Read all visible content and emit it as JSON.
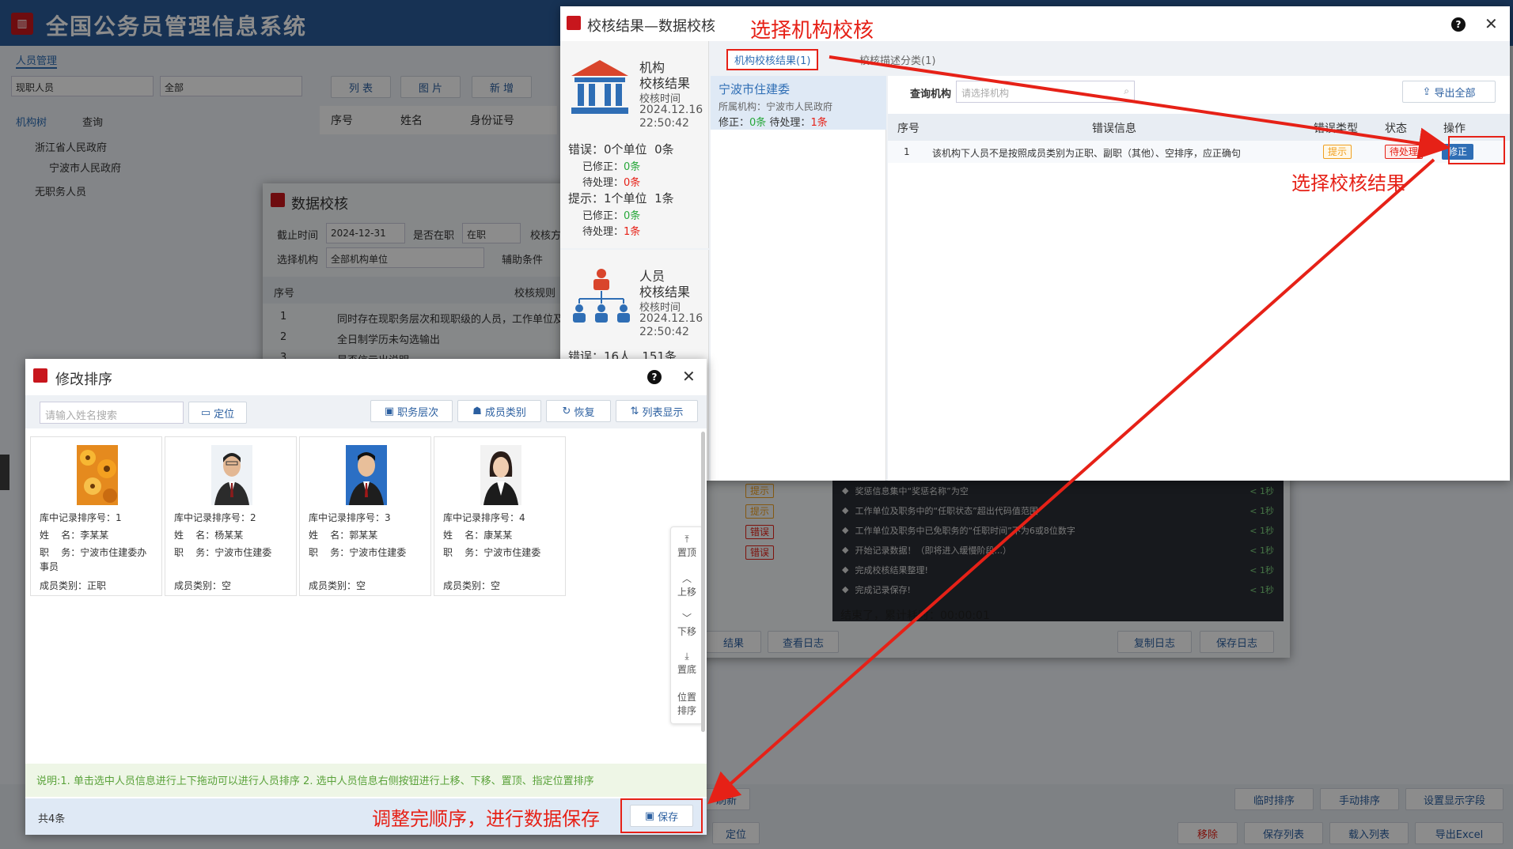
{
  "app": {
    "title": "全国公务员管理信息系统",
    "tab": "人员管理",
    "filter_value": "现职人员",
    "filter2": "全部",
    "left_tabs": [
      "机构树",
      "查询"
    ],
    "tree": [
      "浙江省人民政府",
      "宁波市人民政府",
      "无职务人员"
    ],
    "toolbar": [
      "列 表",
      "图 片",
      "新 增"
    ],
    "table_headers": [
      "序号",
      "姓名",
      "身份证号"
    ],
    "bottom_buttons": [
      "临时排序",
      "手动排序",
      "设置显示字段"
    ],
    "bottom_buttons2": [
      "移除",
      "保存列表",
      "载入列表",
      "导出Excel"
    ],
    "refresh": "刷新",
    "locate": "定位"
  },
  "data_check": {
    "title": "数据校核",
    "cutoff_label": "截止时间",
    "cutoff": "2024-12-31",
    "incumbent_label": "是否在职",
    "incumbent": "在职",
    "check_label": "校核方",
    "org_label": "选择机构",
    "org": "全部机构单位",
    "aux_label": "辅助条件",
    "headers": [
      "序号",
      "校核规则"
    ],
    "rows": [
      {
        "no": "1",
        "rule": "同时存在现职务层次和现职级的人员，工作单位及"
      },
      {
        "no": "2",
        "rule": "全日制学历未勾选输出"
      },
      {
        "no": "3",
        "rule": "是否信示出说明"
      }
    ],
    "tags": [
      {
        "text": "提示",
        "type": "tip"
      },
      {
        "text": "提示",
        "type": "tip"
      },
      {
        "text": "错误",
        "type": "err"
      },
      {
        "text": "错误",
        "type": "err"
      }
    ],
    "log": [
      {
        "text": "奖惩信息集中“奖惩名称”为空",
        "time": "< 1秒"
      },
      {
        "text": "工作单位及职务中的“任职状态”超出代码值范围",
        "time": "< 1秒"
      },
      {
        "text": "工作单位及职务中已免职务的“任职时间”不为6或8位数字",
        "time": "< 1秒"
      },
      {
        "text": "开始记录数据！（即将进入缓慢阶段...）",
        "time": "< 1秒"
      },
      {
        "text": "完成校核结果整理!",
        "time": "< 1秒"
      },
      {
        "text": "完成记录保存!",
        "time": "< 1秒"
      }
    ],
    "finish": "结束了，累计耗时：00:00:01",
    "btn_result": "结果",
    "btn_log": "查看日志",
    "btn_copy": "复制日志",
    "btn_save": "保存日志"
  },
  "result": {
    "title": "校核结果—数据校核",
    "annot_top": "选择机构校核",
    "org_card": {
      "title1": "机构",
      "title2": "校核结果",
      "time_label": "校核时间",
      "date": "2024.12.16",
      "time": "22:50:42",
      "err": "错误：0个单位  0条",
      "err_fixed": "已修正：",
      "err_fixed_v": "0条",
      "err_pending": "待处理：",
      "err_pending_v": "0条",
      "tip": "提示：1个单位  1条",
      "tip_fixed": "已修正：",
      "tip_fixed_v": "0条",
      "tip_pending": "待处理：",
      "tip_pending_v": "1条"
    },
    "person_card": {
      "title1": "人员",
      "title2": "校核结果",
      "time_label": "校核时间",
      "date": "2024.12.16",
      "time": "22:50:42",
      "err": "错误：16人   151条"
    },
    "tabs": [
      "机构校核结果(1)",
      "校核描述分类(1)"
    ],
    "org_item": {
      "name": "宁波市住建委",
      "parent": "所属机构：宁波市人民政府",
      "fix_label": "修正：",
      "fix": "0条",
      "pending_label": "待处理：",
      "pending": "1条"
    },
    "query_label": "查询机构",
    "query_placeholder": "请选择机构",
    "export": "导出全部",
    "headers": [
      "序号",
      "错误信息",
      "错误类型",
      "状态",
      "操作"
    ],
    "rows": [
      {
        "no": "1",
        "msg": "该机构下人员不是按照成员类别为正职、副职（其他）、空排序，应正确句",
        "type": "提示",
        "status": "待处理",
        "op": "修正"
      }
    ],
    "annot_right": "选择校核结果"
  },
  "sort": {
    "title": "修改排序",
    "search_placeholder": "请输入姓名搜索",
    "locate": "定位",
    "buttons": [
      "职务层次",
      "成员类别",
      "恢复",
      "列表显示"
    ],
    "cards": [
      {
        "rec": "库中记录排序号：1",
        "name": "姓    名：李某某",
        "post": "职    务：宁波市住建委办",
        "post2": "事员",
        "type": "成员类别：正职"
      },
      {
        "rec": "库中记录排序号：2",
        "name": "姓    名：杨某某",
        "post": "职    务：宁波市住建委",
        "post2": "",
        "type": "成员类别：空"
      },
      {
        "rec": "库中记录排序号：3",
        "name": "姓    名：郭某某",
        "post": "职    务：宁波市住建委",
        "post2": "",
        "type": "成员类别：空"
      },
      {
        "rec": "库中记录排序号：4",
        "name": "姓    名：康某某",
        "post": "职    务：宁波市住建委",
        "post2": "",
        "type": "成员类别：空"
      }
    ],
    "side": [
      "置顶",
      "上移",
      "下移",
      "置底",
      "位置排序"
    ],
    "note": "说明:1. 单击选中人员信息进行上下拖动可以进行人员排序 2. 选中人员信息右侧按钮进行上移、下移、置顶、指定位置排序",
    "count": "共4条",
    "annot": "调整完顺序，进行数据保存",
    "save": "保存"
  },
  "colors": {
    "accent": "#2f6eb5",
    "annot": "#e62117",
    "tip": "#f0a020",
    "err": "#e62117",
    "ok": "#27a73a"
  }
}
